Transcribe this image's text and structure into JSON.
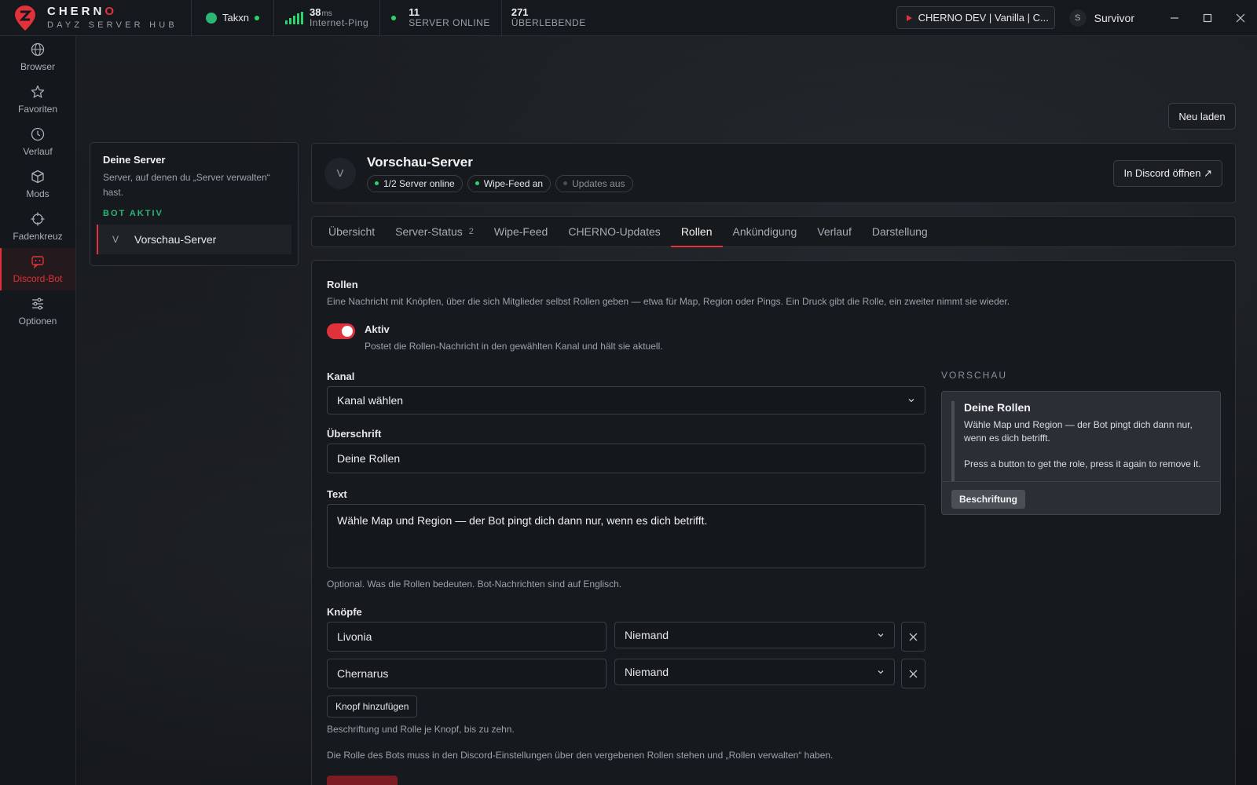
{
  "brand": {
    "title": "CHERN",
    "title_o": "O",
    "subtitle": "DAYZ SERVER HUB"
  },
  "topbar": {
    "user": "Takxn",
    "ping_value": "38",
    "ping_unit": "ms",
    "ping_label": "Internet-Ping",
    "servers_value": "11",
    "servers_label": "SERVER ONLINE",
    "survivors_value": "271",
    "survivors_label": "ÜBERLEBENDE",
    "server_pill": "CHERNO DEV | Vanilla | C...",
    "profile_initial": "S",
    "profile_name": "Survivor"
  },
  "rail": [
    {
      "label": "Browser",
      "icon": "globe-icon"
    },
    {
      "label": "Favoriten",
      "icon": "star-icon"
    },
    {
      "label": "Verlauf",
      "icon": "clock-icon"
    },
    {
      "label": "Mods",
      "icon": "cube-icon"
    },
    {
      "label": "Fadenkreuz",
      "icon": "crosshair-icon"
    },
    {
      "label": "Discord-Bot",
      "icon": "bot-icon"
    },
    {
      "label": "Optionen",
      "icon": "sliders-icon"
    }
  ],
  "servers_panel": {
    "title": "Deine Server",
    "desc": "Server, auf denen du „Server verwalten“ hast.",
    "section": "BOT AKTIV",
    "item_initial": "V",
    "item_name": "Vorschau-Server"
  },
  "reload_label": "Neu laden",
  "header": {
    "initial": "V",
    "title": "Vorschau-Server",
    "badges": [
      "1/2 Server online",
      "Wipe-Feed an",
      "Updates aus"
    ],
    "discord_button": "In Discord öffnen ↗"
  },
  "tabs": [
    {
      "label": "Übersicht"
    },
    {
      "label": "Server-Status",
      "count": "2"
    },
    {
      "label": "Wipe-Feed"
    },
    {
      "label": "CHERNO-Updates"
    },
    {
      "label": "Rollen"
    },
    {
      "label": "Ankündigung"
    },
    {
      "label": "Verlauf"
    },
    {
      "label": "Darstellung"
    }
  ],
  "roles": {
    "title": "Rollen",
    "desc": "Eine Nachricht mit Knöpfen, über die sich Mitglieder selbst Rollen geben — etwa für Map, Region oder Pings. Ein Druck gibt die Rolle, ein zweiter nimmt sie wieder.",
    "toggle_label": "Aktiv",
    "toggle_desc": "Postet die Rollen-Nachricht in den gewählten Kanal und hält sie aktuell.",
    "channel_label": "Kanal",
    "channel_value": "Kanal wählen",
    "heading_label": "Überschrift",
    "heading_value": "Deine Rollen",
    "text_label": "Text",
    "text_value": "Wähle Map und Region — der Bot pingt dich dann nur, wenn es dich betrifft.",
    "text_hint": "Optional. Was die Rollen bedeuten. Bot-Nachrichten sind auf Englisch.",
    "buttons_label": "Knöpfe",
    "buttons": [
      {
        "label": "Livonia",
        "role": "Niemand"
      },
      {
        "label": "Chernarus",
        "role": "Niemand"
      }
    ],
    "add_button": "Knopf hinzufügen",
    "buttons_hint": "Beschriftung und Rolle je Knopf, bis zu zehn.",
    "perm_hint": "Die Rolle des Bots muss in den Discord-Einstellungen über den vergebenen Rollen stehen und „Rollen verwalten“ haben."
  },
  "preview": {
    "label": "VORSCHAU",
    "title": "Deine Rollen",
    "body": "Wähle Map und Region — der Bot pingt dich dann nur, wenn es dich betrifft.",
    "footer": "Press a button to get the role, press it again to remove it.",
    "button": "Beschriftung"
  },
  "colors": {
    "accent": "#e0323a",
    "online": "#2bd46b",
    "bot_active": "#2bb673"
  }
}
